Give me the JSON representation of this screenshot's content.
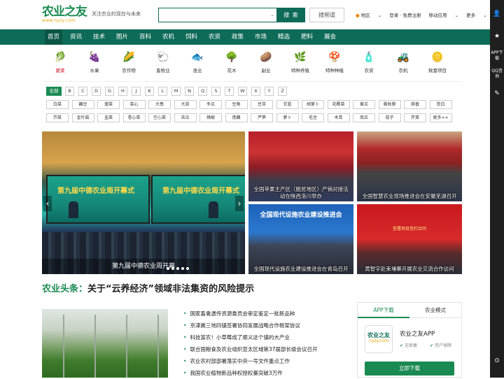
{
  "header": {
    "logo_text": "农业之友",
    "logo_url": "www.nyzy.com",
    "slogan": "关注农业的现在与未来",
    "search_placeholder": "",
    "search_button": "搜 索",
    "channel_button": "搜频道",
    "links": {
      "region": "地区",
      "auth": "登录 · 免费注册",
      "mobile": "移动应用",
      "more": "更多"
    }
  },
  "nav": [
    "首页",
    "资讯",
    "技术",
    "图片",
    "百科",
    "农机",
    "饲料",
    "农资",
    "政策",
    "市场",
    "精选",
    "肥料",
    "展会"
  ],
  "sidebar": {
    "app": "APP下载",
    "qq": "QQ咨询"
  },
  "categories": [
    {
      "label": "蔬菜",
      "icon": "vegetable-icon"
    },
    {
      "label": "水果",
      "icon": "fruit-icon"
    },
    {
      "label": "农作物",
      "icon": "crop-icon"
    },
    {
      "label": "畜牧业",
      "icon": "livestock-icon"
    },
    {
      "label": "渔业",
      "icon": "fish-icon"
    },
    {
      "label": "花木",
      "icon": "tree-icon"
    },
    {
      "label": "副业",
      "icon": "sideline-icon"
    },
    {
      "label": "特种养殖",
      "icon": "special-breeding-icon"
    },
    {
      "label": "特种种植",
      "icon": "mushroom-icon"
    },
    {
      "label": "农资",
      "icon": "agri-supply-icon"
    },
    {
      "label": "农机",
      "icon": "tractor-icon"
    },
    {
      "label": "致富项目",
      "icon": "wealth-icon"
    }
  ],
  "letters": [
    "全部",
    "B",
    "C",
    "D",
    "G",
    "H",
    "J",
    "K",
    "L",
    "M",
    "N",
    "Q",
    "S",
    "T",
    "W",
    "X",
    "Y",
    "Z"
  ],
  "tags_row1": [
    "白菜",
    "藕豆",
    "菠菜",
    "菜心",
    "大葱",
    "大蒜",
    "冬瓜",
    "豆角",
    "豆芽",
    "甘蓝",
    "胡萝卜",
    "花椰菜",
    "黄瓜",
    "黄秋葵",
    "茴香",
    "茭白"
  ],
  "tags_row2": [
    "芥菜",
    "金针菇",
    "韭菜",
    "卷心菜",
    "空心菜",
    "苦瓜",
    "辣椒",
    "莲藕",
    "芦笋",
    "萝卜",
    "毛豆",
    "木耳",
    "南瓜",
    "茄子",
    "芹菜",
    "更多>>"
  ],
  "slideshow": {
    "main_caption": "第九届中德农业周开幕",
    "screen_text": "第九届中德农业周开幕式",
    "thumbs": [
      "全国苹果主产区（脱贫地区）产销对接活动在陕西洛川举办",
      "全国智慧农业现场推进会在安徽芜湖召开",
      "全国现代设施农业建设推进会在青岛召开",
      "黄智宇赴束埔寨开展农业交流合作访问"
    ],
    "t3_banner": "全国现代设施农业建设推进会",
    "t4_banner": "签署项目签约合同",
    "slide_count": 5
  },
  "headline": {
    "prefix": "农业头条：",
    "text": "关于“云养经济”领域非法集资的风险提示"
  },
  "news": [
    "国家畜禽遗传资源委员会审定鉴定一批新品种",
    "京津冀三地四镇签署协同发展战略合作框架协议",
    "科技富农！小草莓成了顺义这个镇的大产业",
    "联合国粮食及农业组织亚太区域第37届部长级会议召开",
    "农业农村部部署落实中央一号文件重点工作",
    "我国农业植物新品种权授权量突破3万件"
  ],
  "app": {
    "tab_download": "APP下载",
    "tab_mode": "农业模式",
    "logo_l1": "农业之友",
    "logo_l2": "nyzy.com",
    "name": "农业之友APP",
    "badge1": "无病毒",
    "badge2": "用户保障",
    "download": "立即下载"
  }
}
